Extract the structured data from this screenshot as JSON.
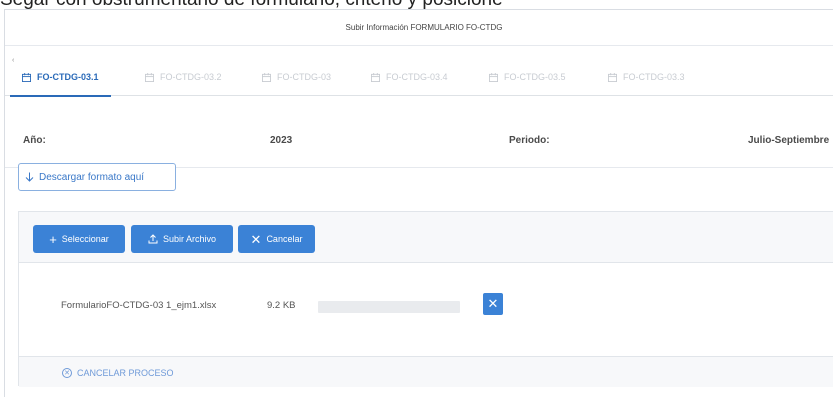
{
  "caption": "Segar con obstrumentario de formulario, criterio y posicione",
  "dialog": {
    "title": "Subir Información FORMULARIO FO-CTDG"
  },
  "tabs": [
    {
      "label": "FO-CTDG-03.1",
      "active": true
    },
    {
      "label": "FO-CTDG-03.2",
      "active": false
    },
    {
      "label": "FO-CTDG-03",
      "active": false
    },
    {
      "label": "FO-CTDG-03.4",
      "active": false
    },
    {
      "label": "FO-CTDG-03.5",
      "active": false
    },
    {
      "label": "FO-CTDG-03.3",
      "active": false
    }
  ],
  "tabs_collapse_glyph": "‹",
  "info": {
    "year_label": "Año:",
    "year_value": "2023",
    "period_label": "Periodo:",
    "period_value": "Julio-Septiembre"
  },
  "download": {
    "label": "Descargar formato aquí",
    "icon": "arrow-down-icon"
  },
  "upload": {
    "select_label": "Seleccionar",
    "upload_label": "Subir Archivo",
    "cancel_label": "Cancelar",
    "file": {
      "name": "FormularioFO-CTDG-03 1_ejm1.xlsx",
      "size": "9.2 KB",
      "progress_percent": 0
    },
    "cancel_process_label": "CANCELAR PROCESO"
  },
  "colors": {
    "accent": "#3b82d6",
    "active_tab": "#2a6ab8",
    "inactive_tab": "#c8ccd2"
  }
}
